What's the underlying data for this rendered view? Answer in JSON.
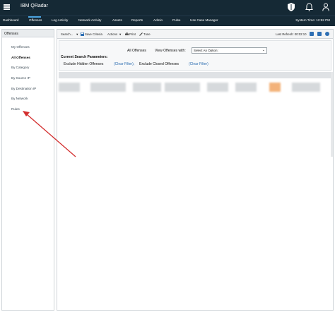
{
  "app": {
    "title": "IBM QRadar"
  },
  "nav": {
    "tabs": [
      {
        "label": "Dashboard"
      },
      {
        "label": "Offenses"
      },
      {
        "label": "Log Activity"
      },
      {
        "label": "Network Activity"
      },
      {
        "label": "Assets"
      },
      {
        "label": "Reports"
      },
      {
        "label": "Admin"
      },
      {
        "label": "Pulse"
      },
      {
        "label": "Use Case Manager"
      }
    ],
    "active_tab": "Offenses",
    "system_time": "System Time: 12:52 PM"
  },
  "icons": {
    "menu": "hamburger-icon",
    "mute": "shield-icon",
    "notifications": "bell-icon",
    "user": "user-icon"
  },
  "sidebar": {
    "title": "Offenses",
    "items": [
      {
        "label": "My Offenses"
      },
      {
        "label": "All Offenses"
      },
      {
        "label": "By Category"
      },
      {
        "label": "By Source IP"
      },
      {
        "label": "By Destination IP"
      },
      {
        "label": "By Network"
      },
      {
        "label": "Rules"
      }
    ],
    "active_item": "All Offenses"
  },
  "toolbar": {
    "search_label": "Search...",
    "save_criteria_label": "Save Criteria",
    "actions_label": "Actions",
    "print_label": "Print",
    "tune_label": "Tune",
    "last_refresh": "Last Refresh: 00:02:10"
  },
  "criteria": {
    "current_label": "Current Search Parameters:",
    "view_title": "All Offenses",
    "view_with_label": "View Offenses with:",
    "select_value": "Select An Option:",
    "exclude_hidden": "Exclude Hidden Offenses",
    "clear_filter_1": "(Clear Filter),",
    "exclude_closed": "Exclude Closed Offenses",
    "clear_filter_2": "(Clear Filter)"
  },
  "colors": {
    "topbar": "#152935",
    "accent_link": "#2b6cb0",
    "annotation_arrow": "#d32f2f"
  }
}
